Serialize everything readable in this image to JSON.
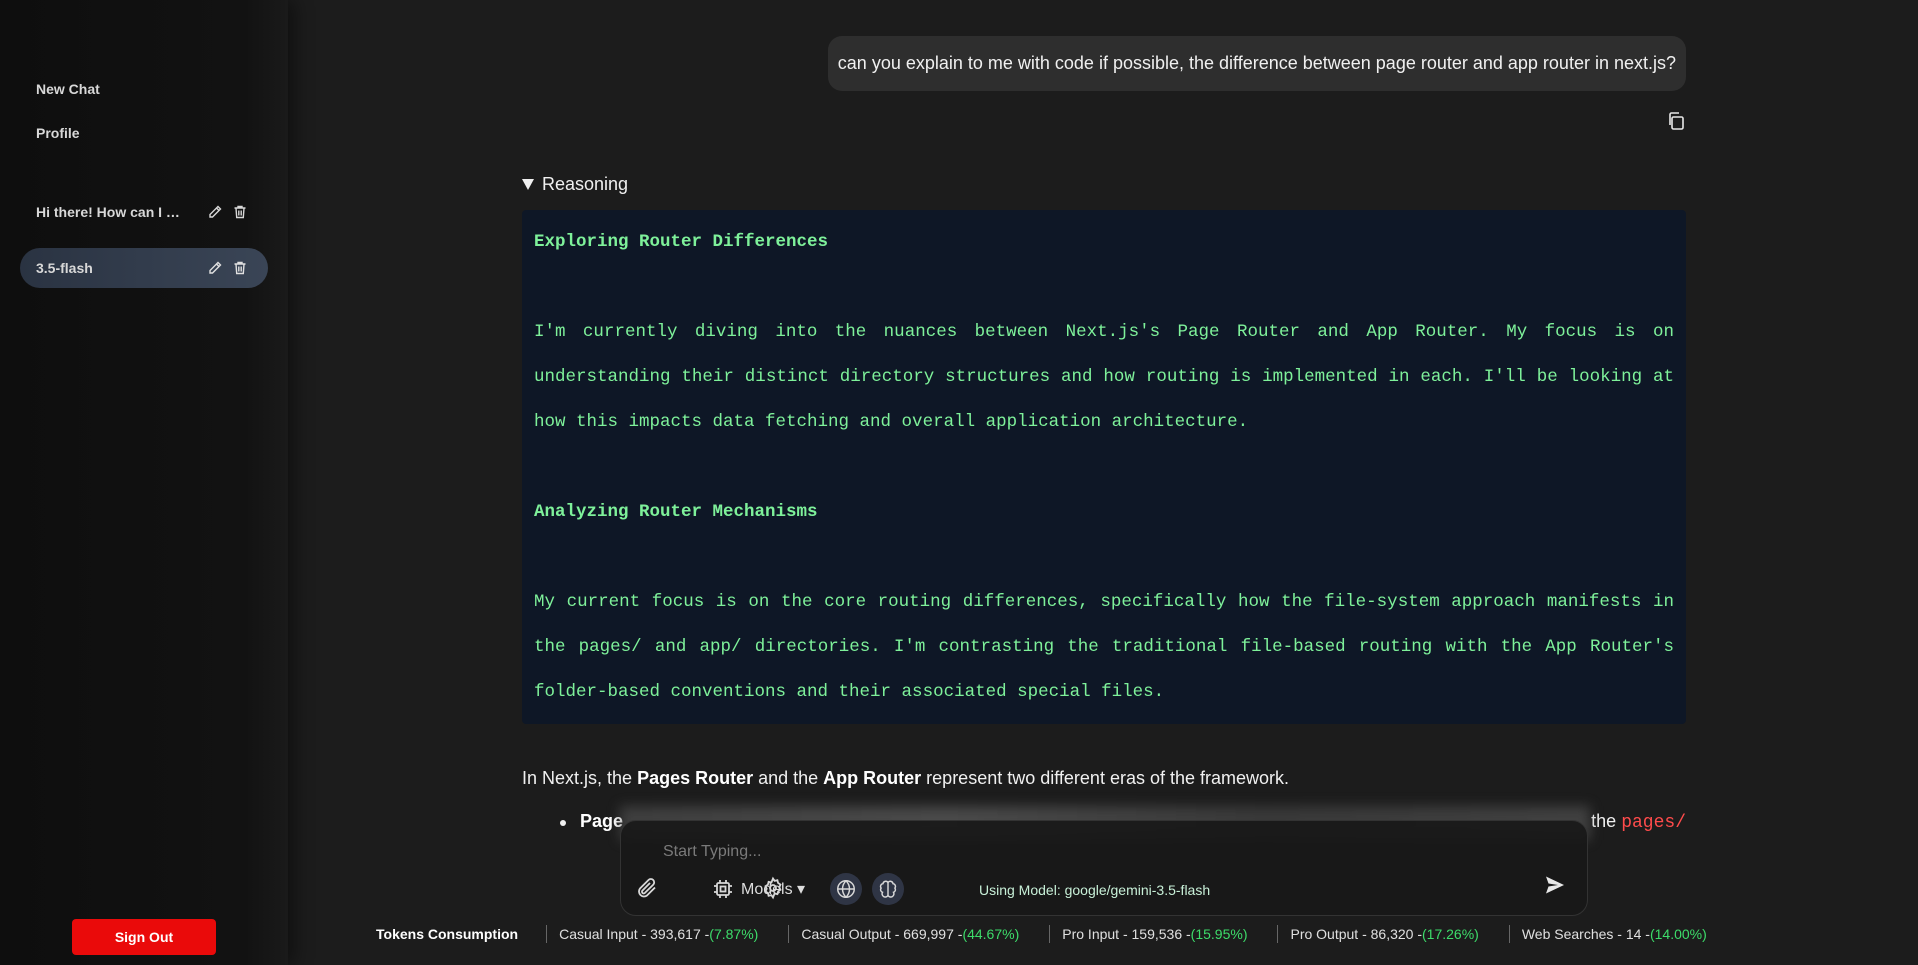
{
  "sidebar": {
    "new_chat": "New Chat",
    "profile": "Profile",
    "chats": [
      {
        "label": "Hi there! How can I help you today?"
      },
      {
        "label": "3.5-flash"
      }
    ],
    "sign_out": "Sign Out"
  },
  "conversation": {
    "user_message": "can you explain to me with code if possible, the difference between page router and app router in next.js?",
    "reasoning": {
      "summary": "Reasoning",
      "heading_1": "Exploring Router Differences",
      "paragraph_1": "I'm currently diving into the nuances between Next.js's Page Router and App Router. My focus is on understanding their distinct directory structures and how routing is implemented in each. I'll be looking at how this impacts data fetching and overall application architecture.",
      "heading_2": "Analyzing Router Mechanisms",
      "paragraph_2": "My current focus is on the core routing differences, specifically how the file-system approach manifests in the pages/ and app/ directories. I'm contrasting the traditional file-based routing with the App Router's folder-based conventions and their associated special files."
    },
    "answer": {
      "prefix": "In Next.js, the ",
      "bold_1": "Pages Router",
      "middle": " and the ",
      "bold_2": "App Router",
      "suffix": " represent two different eras of the framework.",
      "bullet_strong": "Page",
      "bullet_tail": "the ",
      "bullet_code": "pages/"
    }
  },
  "composer": {
    "placeholder": "Start Typing...",
    "models_label": "Models ▾",
    "model_in_use": "Using Model: google/gemini-3.5-flash"
  },
  "tokens": {
    "title": "Tokens Consumption",
    "stats": [
      {
        "label": "Casual Input - 393,617 - ",
        "pct": "(7.87%)"
      },
      {
        "label": "Casual Output - 669,997 - ",
        "pct": "(44.67%)"
      },
      {
        "label": "Pro Input - 159,536 - ",
        "pct": "(15.95%)"
      },
      {
        "label": "Pro Output - 86,320 - ",
        "pct": "(17.26%)"
      },
      {
        "label": "Web Searches - 14 - ",
        "pct": "(14.00%)"
      }
    ]
  },
  "colors": {
    "accent_green": "#7ef19a",
    "sign_out_red": "#ea0a0a",
    "percent_green": "#3ddc6a",
    "code_red": "#ff4b4b"
  },
  "icons": {
    "edit": "pencil-icon",
    "delete": "trash-icon",
    "copy": "copy-icon",
    "attach": "paperclip-icon",
    "models": "chip-icon",
    "settings": "gear-icon",
    "web": "globe-icon",
    "reasoning": "brain-icon",
    "send": "send-icon"
  }
}
